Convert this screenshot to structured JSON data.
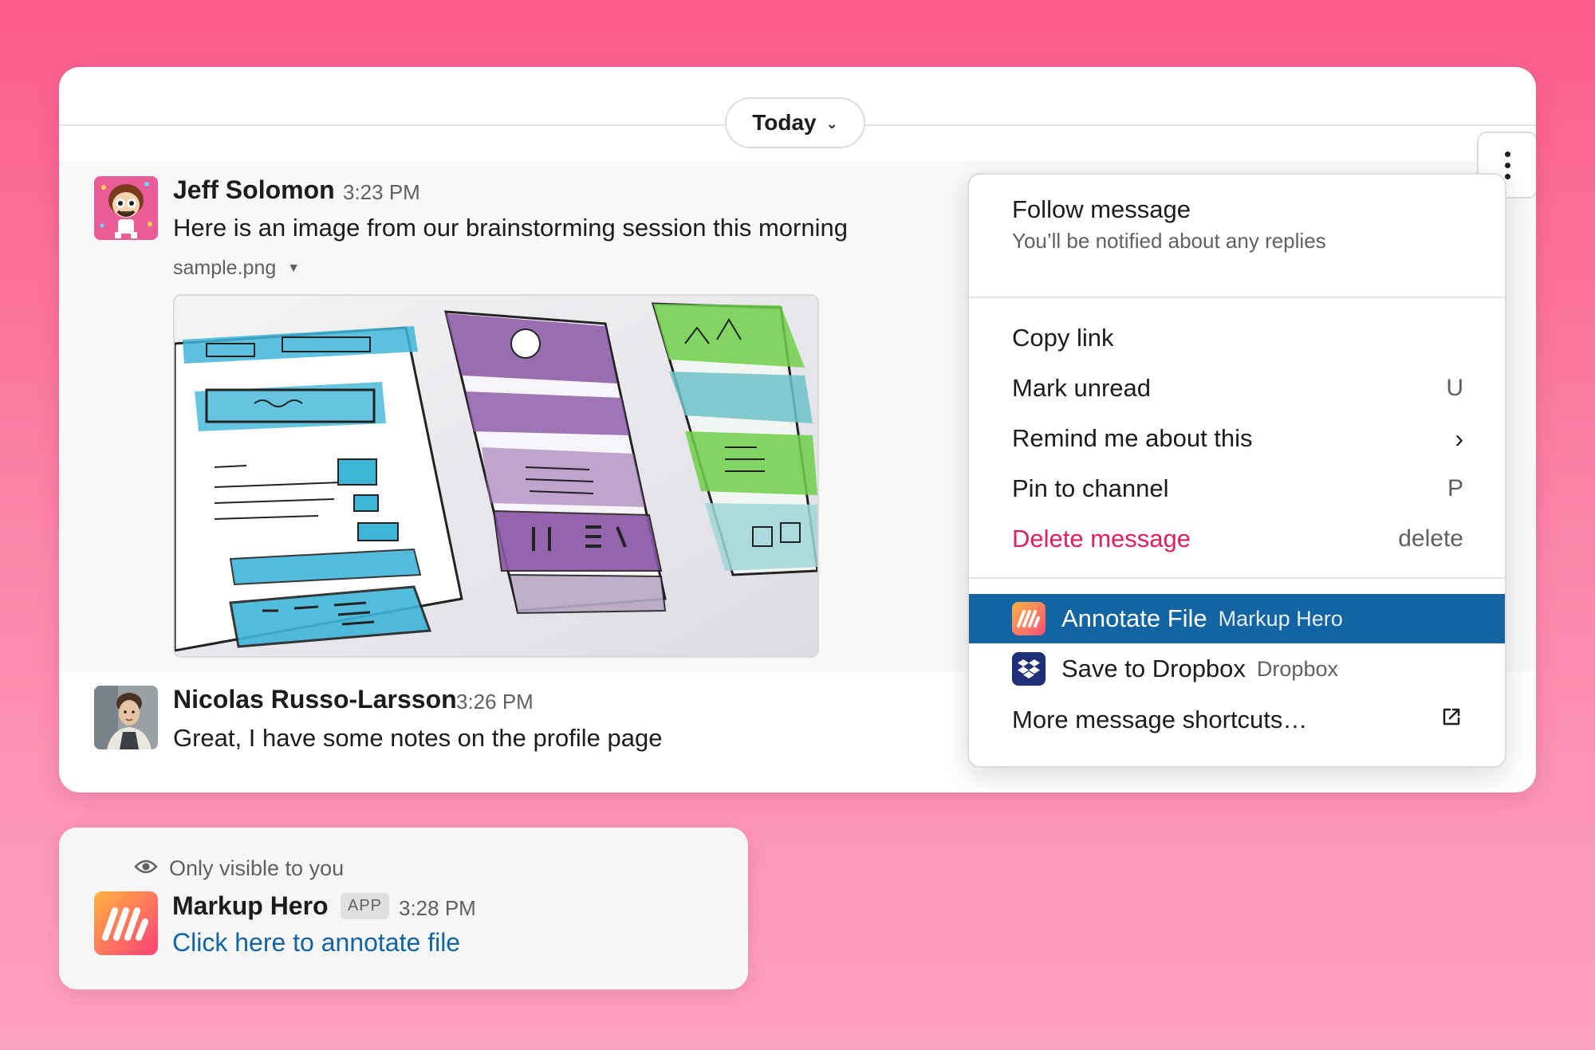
{
  "header": {
    "date_label": "Today"
  },
  "messages": [
    {
      "author": "Jeff Solomon",
      "time": "3:23 PM",
      "text": "Here is an image from our brainstorming session this morning",
      "file_name": "sample.png"
    },
    {
      "author": "Nicolas Russo-Larsson",
      "time": "3:26 PM",
      "text": "Great, I have some notes on the profile page"
    }
  ],
  "menu": {
    "follow": {
      "label": "Follow message",
      "hint": "You’ll be notified about any replies"
    },
    "items": [
      {
        "label": "Copy link",
        "shortcut": ""
      },
      {
        "label": "Mark unread",
        "shortcut": "U"
      },
      {
        "label": "Remind me about this",
        "shortcut": "›"
      },
      {
        "label": "Pin to channel",
        "shortcut": "P"
      },
      {
        "label": "Delete message",
        "shortcut": "delete"
      }
    ],
    "shortcuts": [
      {
        "label": "Annotate File",
        "app": "Markup Hero",
        "icon": "markup-hero-logo",
        "highlighted": true
      },
      {
        "label": "Save to Dropbox",
        "app": "Dropbox",
        "icon": "dropbox-logo",
        "highlighted": false
      }
    ],
    "more": {
      "label": "More message shortcuts…",
      "icon": "external-link-icon"
    },
    "colors": {
      "highlight": "#1264a3",
      "danger": "#e01e5a"
    }
  },
  "ephemeral": {
    "visibility": "Only visible to you",
    "author": "Markup Hero",
    "tag": "APP",
    "time": "3:28 PM",
    "link_text": "Click here to annotate file",
    "link_color": "#1264a3"
  },
  "colors": {
    "background_top": "#fb5c8c",
    "background_bottom": "#fda2c0"
  }
}
